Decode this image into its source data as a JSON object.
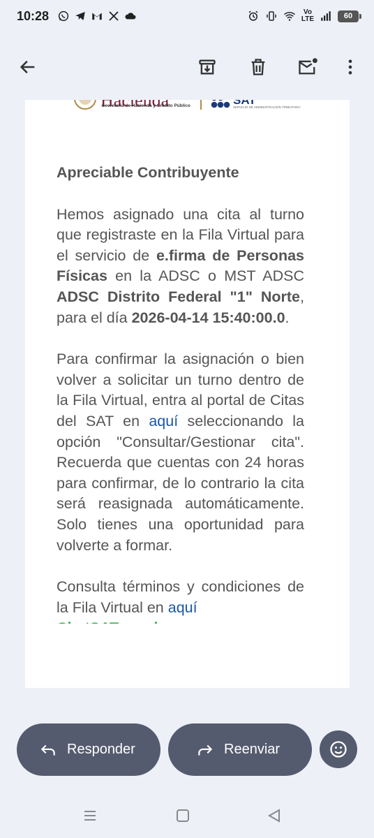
{
  "status_bar": {
    "time": "10:28",
    "left_icons": [
      "whatsapp-icon",
      "telegram-icon",
      "gmail-icon",
      "x-icon",
      "cloud-icon"
    ],
    "right_icons": [
      "alarm-icon",
      "vibrate-icon",
      "wifi-icon",
      "volte-icon",
      "signal-icon"
    ],
    "volte_label": "Vo\nLTE",
    "battery": "60"
  },
  "action_bar": {
    "icons": [
      "back-arrow-icon",
      "archive-icon",
      "delete-icon",
      "mark-unread-icon",
      "more-vert-icon"
    ]
  },
  "email": {
    "header": {
      "hacienda_title": "Hacienda",
      "hacienda_subtitle": "Secretaría de Hacienda y Crédito Público",
      "sat_title": "SAT",
      "sat_subtitle": "SERVICIO DE ADMINISTRACIÓN TRIBUTARIA"
    },
    "greeting": "Apreciable Contribuyente",
    "p1": {
      "t1": "Hemos asignado una cita al turno que registraste en la Fila Virtual para el servicio de ",
      "b1": "e.firma de Personas Físicas",
      "t2": " en la ADSC o MST ADSC ",
      "b2": "ADSC Distrito Federal \"1\" Norte",
      "t3": ", para el día ",
      "b3": "2026-04-14 15:40:00.0",
      "t4": "."
    },
    "p2": {
      "t1": "Para confirmar la asignación o bien volver a solicitar un turno dentro de la Fila Virtual, entra al portal de Citas del SAT en ",
      "link": "aquí",
      "t2": " seleccionando la opción \"Consultar/Gestionar cita\". Recuerda que cuentas con 24 horas para confirmar, de lo contrario la cita será reasignada automáticamente. Solo tienes una oportunidad para volverte a formar."
    },
    "p3": {
      "t1": "Consulta términos y condiciones de la Fila Virtual en ",
      "link": "aquí"
    },
    "cut_off_line": "ChatSAT ayuda"
  },
  "actions": {
    "reply_label": "Responder",
    "forward_label": "Reenviar"
  },
  "colors": {
    "background": "#eef0f8",
    "pill": "#555b6e",
    "link": "#1a57a8",
    "body_text": "#555555",
    "hacienda": "#7a1f3d",
    "sat": "#1a3a7a"
  }
}
